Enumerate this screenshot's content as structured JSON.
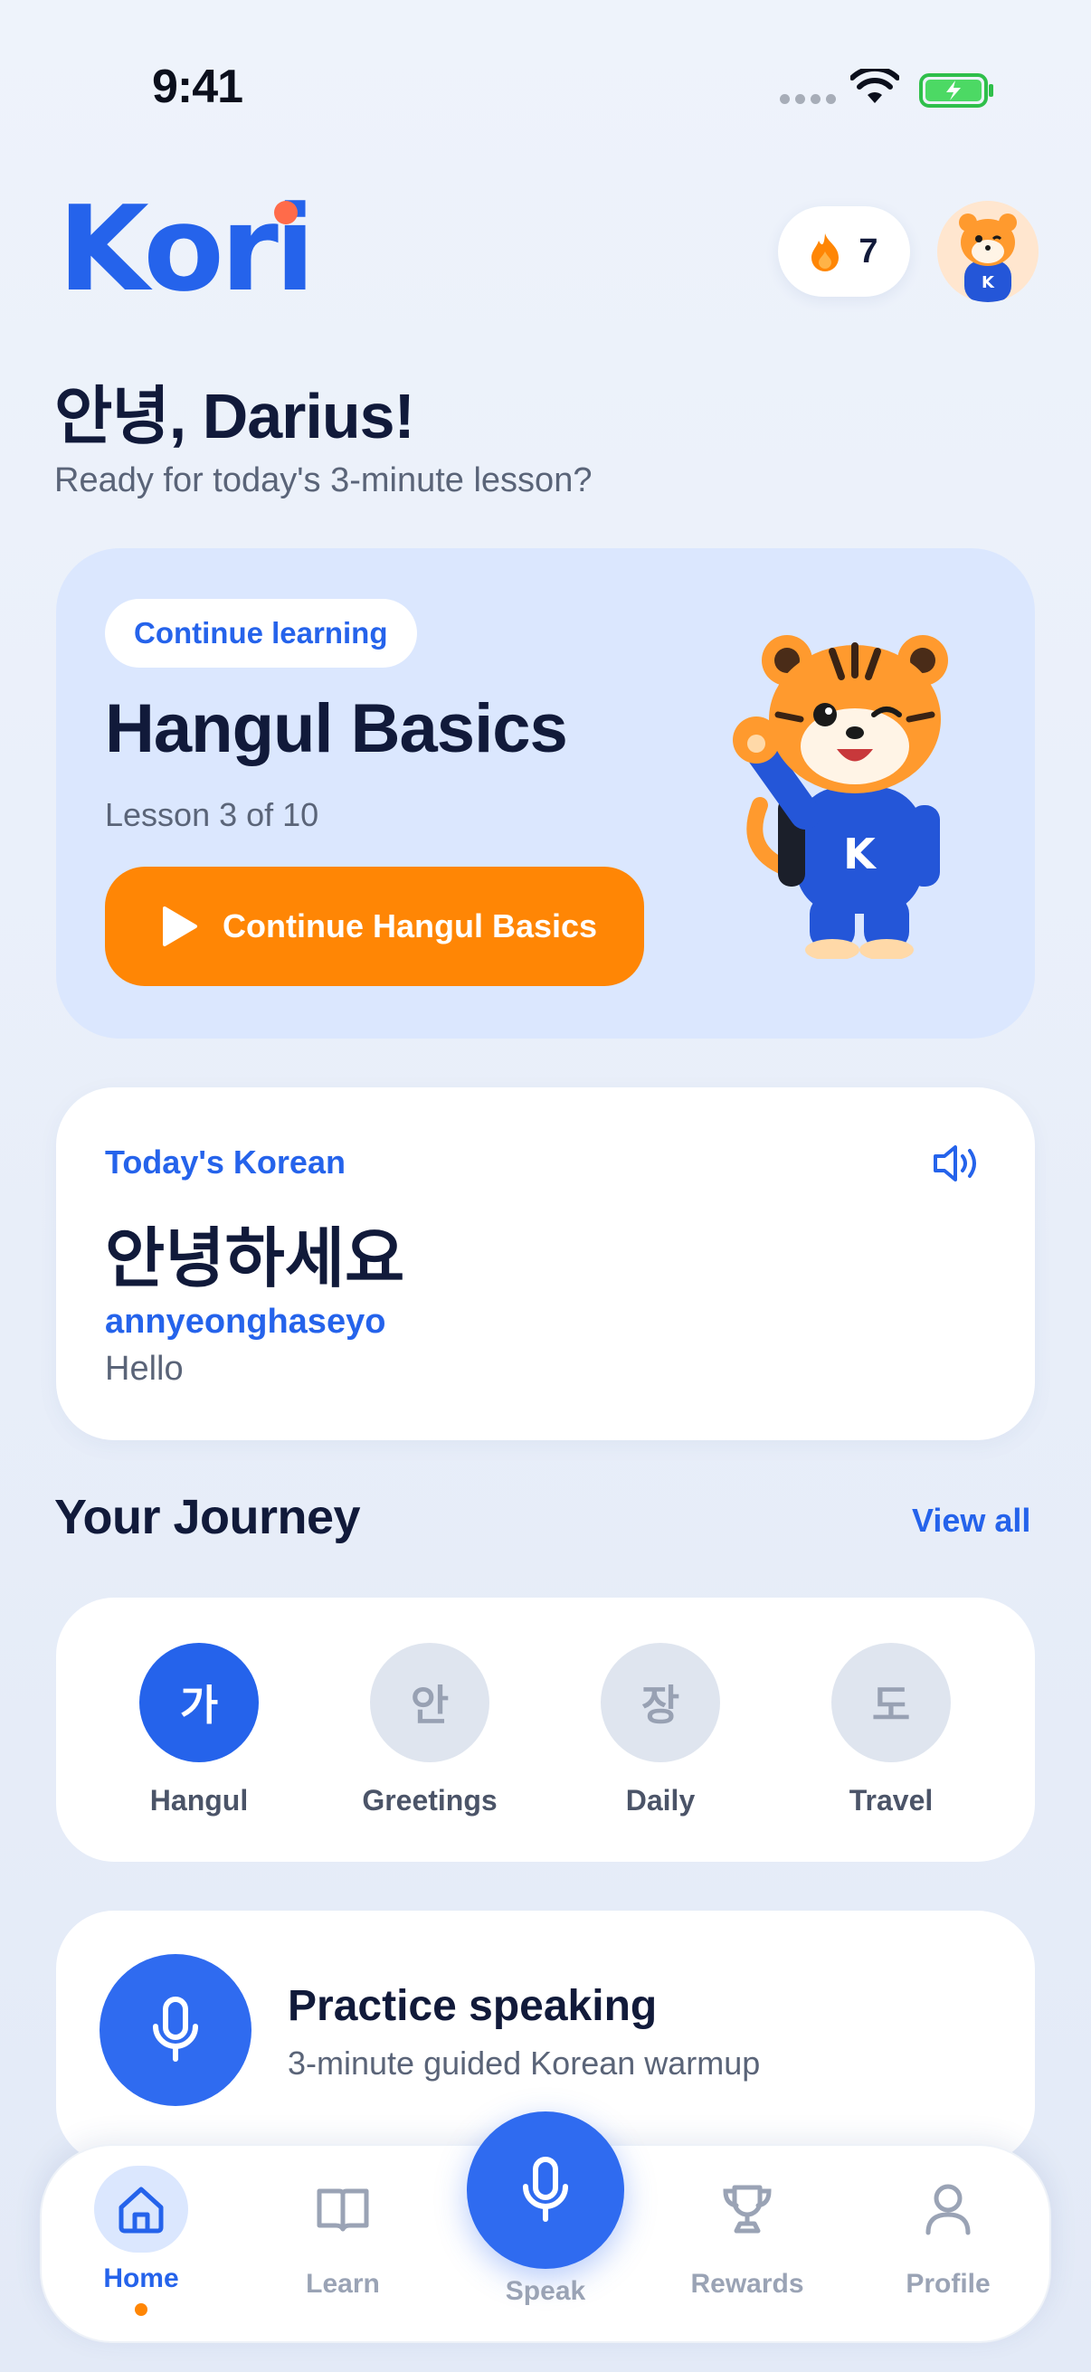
{
  "status_bar": {
    "time": "9:41"
  },
  "header": {
    "logo": "Kori",
    "streak_count": "7"
  },
  "greeting": {
    "title": "안녕, Darius!",
    "subtitle": "Ready for today's 3-minute lesson?"
  },
  "hero": {
    "pill": "Continue learning",
    "title": "Hangul Basics",
    "lesson": "Lesson 3 of 10",
    "cta_label": "Continue Hangul Basics"
  },
  "today": {
    "label": "Today's Korean",
    "word": "안녕하세요",
    "romanization": "annyeonghaseyo",
    "meaning": "Hello"
  },
  "journey": {
    "title": "Your Journey",
    "view_all": "View all",
    "items": [
      {
        "glyph": "가",
        "label": "Hangul",
        "active": true
      },
      {
        "glyph": "안",
        "label": "Greetings",
        "active": false
      },
      {
        "glyph": "장",
        "label": "Daily",
        "active": false
      },
      {
        "glyph": "도",
        "label": "Travel",
        "active": false
      }
    ]
  },
  "practice": {
    "title": "Practice speaking",
    "subtitle": "3-minute guided Korean warmup"
  },
  "nav": {
    "home": "Home",
    "learn": "Learn",
    "speak": "Speak",
    "rewards": "Rewards",
    "profile": "Profile",
    "active": "home"
  },
  "colors": {
    "primary": "#2563eb",
    "accent": "#ff8605",
    "hero_bg": "#dbe7fe",
    "logo_dot": "#ff6b4a"
  },
  "icons": [
    "wifi-icon",
    "battery-icon",
    "flame-icon",
    "play-icon",
    "speaker-icon",
    "mic-icon",
    "home-icon",
    "book-icon",
    "trophy-icon",
    "person-icon"
  ]
}
